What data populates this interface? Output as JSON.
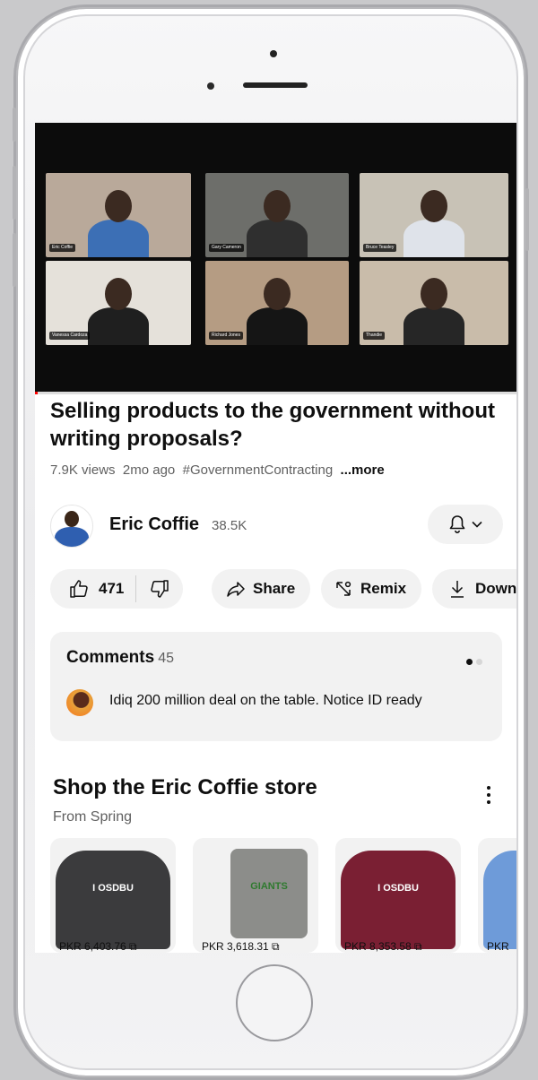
{
  "video": {
    "participants": [
      {
        "name_tag": "Eric Coffie",
        "bg": "#b9a99a",
        "shirt": "#3c6fb5"
      },
      {
        "name_tag": "Gary Cameron",
        "bg": "#6d6e6a",
        "shirt": "#2f2f2f"
      },
      {
        "name_tag": "Bruce Teasley",
        "bg": "#c8c2b6",
        "shirt": "#dfe3ea"
      },
      {
        "name_tag": "Vanessa Cardoza",
        "bg": "#e5e1da",
        "shirt": "#1f1f1f"
      },
      {
        "name_tag": "Richard Jones",
        "bg": "#b59c83",
        "shirt": "#151515"
      },
      {
        "name_tag": "Thandie",
        "bg": "#c9bcaa",
        "shirt": "#262626"
      }
    ],
    "progress_fraction": 0.005
  },
  "title": "Selling products to the government without writing proposals?",
  "meta": {
    "views": "7.9K views",
    "age": "2mo ago",
    "hashtag": "#GovernmentContracting",
    "more": "...more"
  },
  "channel": {
    "name": "Eric Coffie",
    "subscribers": "38.5K"
  },
  "actions": {
    "likes": "471",
    "share": "Share",
    "remix": "Remix",
    "download": "Down"
  },
  "comments": {
    "title": "Comments",
    "count": "45",
    "top_comment": "Idiq 200 million deal on the table. Notice ID ready"
  },
  "shop": {
    "title": "Shop the Eric Coffie  store",
    "subtitle": "From Spring",
    "products": [
      {
        "price": "PKR 6,403.76",
        "color": "#3b3b3d",
        "print": "I OSDBU"
      },
      {
        "price": "PKR 3,618.31",
        "color": "#8c8d8a",
        "print": "GIANTS"
      },
      {
        "price": "PKR 8,353.58",
        "color": "#7a1f33",
        "print": "I OSDBU"
      },
      {
        "price": "PKR",
        "color": "#6e9bd9",
        "print": ""
      }
    ]
  },
  "colors": {
    "accent": "#ff0000",
    "text": "#0f0f0f",
    "muted": "#606060",
    "pill": "#f2f2f2"
  }
}
